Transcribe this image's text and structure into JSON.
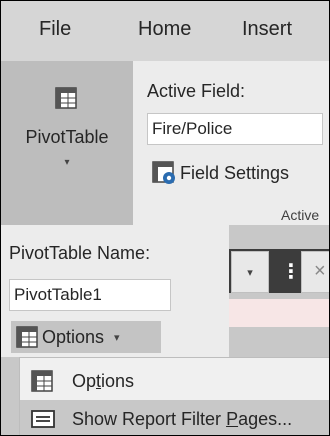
{
  "tabs": [
    "File",
    "Home",
    "Insert"
  ],
  "pivot_button": {
    "label": "PivotTable",
    "icon": "pivot-table-icon"
  },
  "active_field": {
    "label": "Active Field:",
    "value": "Fire/Police",
    "field_settings_label": "Field Settings",
    "group_label": "Active"
  },
  "pivot_name": {
    "label": "PivotTable Name:",
    "value": "PivotTable1",
    "options_label": "Options"
  },
  "menu": {
    "items": [
      {
        "label_plain": "Op",
        "label_u": "t",
        "label_rest": "ions",
        "icon": "options-icon"
      },
      {
        "label_plain": "Show Report Filter ",
        "label_u": "P",
        "label_rest": "ages...",
        "icon": "report-filter-icon"
      }
    ]
  },
  "colors": {
    "selected_tab_bg": "#bdbdbd",
    "menu_highlight": "#c8c8c8",
    "accent_blue": "#2b6cb0"
  }
}
